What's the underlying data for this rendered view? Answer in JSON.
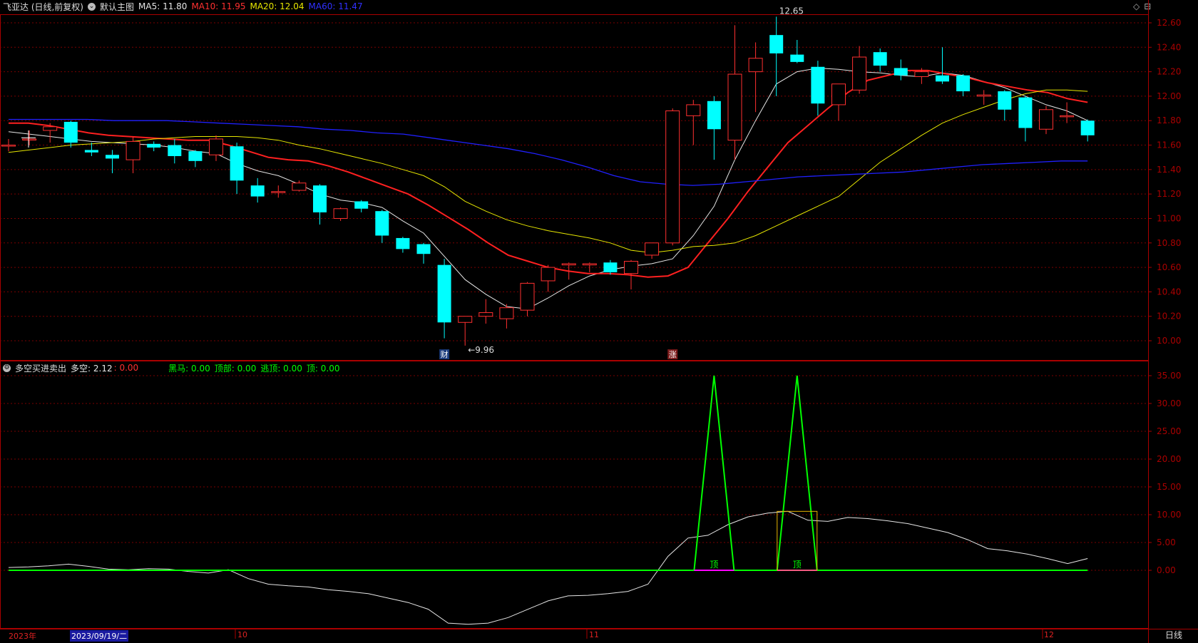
{
  "main_header": {
    "title": "飞亚达 (日线,前复权)",
    "main_label": "默认主图",
    "ma5": "MA5: 11.80",
    "ma10": "MA10: 11.95",
    "ma20": "MA20: 12.04",
    "ma60": "MA60: 11.47"
  },
  "sub_header": {
    "title": "多空买进卖出",
    "duokong": "多空: 2.12",
    "zero": ": 0.00",
    "heima": "黑马: 0.00",
    "dingbu": "顶部: 0.00",
    "taoding": "逃顶: 0.00",
    "ding": "顶: 0.00"
  },
  "date_axis": {
    "labels": [
      "2023年",
      "10",
      "11",
      "12"
    ],
    "selected_date": "2023/09/19/二",
    "period_button": "日线"
  },
  "colors": {
    "up": "#ff3030",
    "down": "#00ffff",
    "ma5": "#e6e6e6",
    "ma10": "#ff2020",
    "ma20": "#e6e600",
    "ma60": "#2020ff",
    "grid": "#7a0000",
    "axis": "#aa0000",
    "green": "#00ff00",
    "magenta": "#ff00ff"
  },
  "chart_data": [
    {
      "type": "candlestick",
      "name": "main",
      "ylim": [
        9.85,
        12.75
      ],
      "yticks": [
        "12.60",
        "12.40",
        "12.20",
        "12.00",
        "11.80",
        "11.60",
        "11.40",
        "11.20",
        "11.00",
        "10.80",
        "10.60",
        "10.40",
        "10.20",
        "10.00"
      ],
      "candles": [
        {
          "o": 11.6,
          "h": 11.65,
          "l": 11.55,
          "c": 11.6
        },
        {
          "o": 11.65,
          "h": 11.72,
          "l": 11.6,
          "c": 11.65
        },
        {
          "o": 11.72,
          "h": 11.78,
          "l": 11.62,
          "c": 11.75
        },
        {
          "o": 11.79,
          "h": 11.8,
          "l": 11.58,
          "c": 11.62
        },
        {
          "o": 11.56,
          "h": 11.62,
          "l": 11.51,
          "c": 11.54
        },
        {
          "o": 11.52,
          "h": 11.56,
          "l": 11.37,
          "c": 11.49
        },
        {
          "o": 11.48,
          "h": 11.67,
          "l": 11.37,
          "c": 11.63
        },
        {
          "o": 11.61,
          "h": 11.63,
          "l": 11.55,
          "c": 11.58
        },
        {
          "o": 11.6,
          "h": 11.65,
          "l": 11.45,
          "c": 11.51
        },
        {
          "o": 11.55,
          "h": 11.56,
          "l": 11.42,
          "c": 11.47
        },
        {
          "o": 11.52,
          "h": 11.68,
          "l": 11.47,
          "c": 11.65
        },
        {
          "o": 11.59,
          "h": 11.62,
          "l": 11.2,
          "c": 11.31
        },
        {
          "o": 11.27,
          "h": 11.33,
          "l": 11.13,
          "c": 11.18
        },
        {
          "o": 11.22,
          "h": 11.27,
          "l": 11.17,
          "c": 11.22
        },
        {
          "o": 11.23,
          "h": 11.31,
          "l": 11.22,
          "c": 11.29
        },
        {
          "o": 11.27,
          "h": 11.28,
          "l": 10.95,
          "c": 11.05
        },
        {
          "o": 11.0,
          "h": 11.09,
          "l": 10.98,
          "c": 11.08
        },
        {
          "o": 11.14,
          "h": 11.15,
          "l": 11.05,
          "c": 11.08
        },
        {
          "o": 11.06,
          "h": 11.07,
          "l": 10.8,
          "c": 10.86
        },
        {
          "o": 10.84,
          "h": 10.85,
          "l": 10.72,
          "c": 10.75
        },
        {
          "o": 10.79,
          "h": 10.8,
          "l": 10.63,
          "c": 10.71
        },
        {
          "o": 10.62,
          "h": 10.67,
          "l": 10.02,
          "c": 10.15
        },
        {
          "o": 10.15,
          "h": 10.2,
          "l": 9.96,
          "c": 10.2
        },
        {
          "o": 10.2,
          "h": 10.34,
          "l": 10.14,
          "c": 10.23
        },
        {
          "o": 10.18,
          "h": 10.3,
          "l": 10.1,
          "c": 10.27
        },
        {
          "o": 10.25,
          "h": 10.48,
          "l": 10.2,
          "c": 10.47
        },
        {
          "o": 10.49,
          "h": 10.62,
          "l": 10.4,
          "c": 10.6
        },
        {
          "o": 10.62,
          "h": 10.64,
          "l": 10.5,
          "c": 10.63
        },
        {
          "o": 10.62,
          "h": 10.64,
          "l": 10.56,
          "c": 10.63
        },
        {
          "o": 10.64,
          "h": 10.66,
          "l": 10.54,
          "c": 10.56
        },
        {
          "o": 10.55,
          "h": 10.66,
          "l": 10.42,
          "c": 10.65
        },
        {
          "o": 10.7,
          "h": 10.8,
          "l": 10.67,
          "c": 10.8
        },
        {
          "o": 10.8,
          "h": 11.9,
          "l": 10.78,
          "c": 11.88
        },
        {
          "o": 11.84,
          "h": 11.97,
          "l": 11.6,
          "c": 11.93
        },
        {
          "o": 11.96,
          "h": 12.0,
          "l": 11.48,
          "c": 11.73
        },
        {
          "o": 11.64,
          "h": 12.58,
          "l": 11.48,
          "c": 12.18
        },
        {
          "o": 12.2,
          "h": 12.44,
          "l": 11.87,
          "c": 12.31
        },
        {
          "o": 12.5,
          "h": 12.65,
          "l": 12.0,
          "c": 12.35
        },
        {
          "o": 12.34,
          "h": 12.46,
          "l": 12.27,
          "c": 12.28
        },
        {
          "o": 12.24,
          "h": 12.29,
          "l": 11.84,
          "c": 11.94
        },
        {
          "o": 11.93,
          "h": 12.1,
          "l": 11.8,
          "c": 12.1
        },
        {
          "o": 12.05,
          "h": 12.41,
          "l": 12.02,
          "c": 12.32
        },
        {
          "o": 12.36,
          "h": 12.39,
          "l": 12.2,
          "c": 12.25
        },
        {
          "o": 12.23,
          "h": 12.3,
          "l": 12.13,
          "c": 12.17
        },
        {
          "o": 12.16,
          "h": 12.23,
          "l": 12.1,
          "c": 12.2
        },
        {
          "o": 12.17,
          "h": 12.4,
          "l": 12.1,
          "c": 12.12
        },
        {
          "o": 12.17,
          "h": 12.18,
          "l": 12.0,
          "c": 12.04
        },
        {
          "o": 12.0,
          "h": 12.05,
          "l": 11.93,
          "c": 12.01
        },
        {
          "o": 12.04,
          "h": 12.05,
          "l": 11.8,
          "c": 11.89
        },
        {
          "o": 11.99,
          "h": 12.0,
          "l": 11.63,
          "c": 11.74
        },
        {
          "o": 11.73,
          "h": 11.92,
          "l": 11.69,
          "c": 11.89
        },
        {
          "o": 11.84,
          "h": 11.95,
          "l": 11.78,
          "c": 11.84
        },
        {
          "o": 11.8,
          "h": 11.81,
          "l": 11.63,
          "c": 11.68
        }
      ],
      "series": [
        {
          "name": "MA5",
          "values": [
            11.71,
            11.69,
            11.67,
            11.65,
            11.63,
            11.62,
            11.61,
            11.6,
            11.58,
            11.55,
            11.53,
            11.45,
            11.39,
            11.35,
            11.28,
            11.2,
            11.15,
            11.13,
            11.09,
            10.98,
            10.88,
            10.69,
            10.5,
            10.38,
            10.28,
            10.26,
            10.35,
            10.45,
            10.53,
            10.58,
            10.61,
            10.63,
            10.67,
            10.86,
            11.1,
            11.48,
            11.8,
            12.1,
            12.2,
            12.23,
            12.22,
            12.2,
            12.19,
            12.17,
            12.16,
            12.19,
            12.17,
            12.12,
            12.07,
            12.0,
            11.93,
            11.88,
            11.8
          ]
        },
        {
          "name": "MA10",
          "values": [
            11.78,
            11.78,
            11.76,
            11.73,
            11.7,
            11.68,
            11.67,
            11.66,
            11.65,
            11.64,
            11.64,
            11.6,
            11.55,
            11.5,
            11.48,
            11.47,
            11.43,
            11.38,
            11.32,
            11.26,
            11.2,
            11.11,
            11.01,
            10.91,
            10.8,
            10.7,
            10.65,
            10.6,
            10.57,
            10.55,
            10.55,
            10.54,
            10.52,
            10.53,
            10.6,
            10.8,
            11.0,
            11.22,
            11.42,
            11.62,
            11.76,
            11.9,
            12.03,
            12.13,
            12.17,
            12.21,
            12.21,
            12.18,
            12.15,
            12.11,
            12.08,
            12.05,
            12.03,
            11.98,
            11.95
          ]
        },
        {
          "name": "MA20",
          "values": [
            11.54,
            11.56,
            11.58,
            11.6,
            11.61,
            11.62,
            11.63,
            11.65,
            11.66,
            11.67,
            11.67,
            11.67,
            11.66,
            11.64,
            11.6,
            11.57,
            11.53,
            11.49,
            11.45,
            11.4,
            11.35,
            11.26,
            11.14,
            11.06,
            10.99,
            10.94,
            10.9,
            10.87,
            10.84,
            10.8,
            10.74,
            10.72,
            10.74,
            10.77,
            10.78,
            10.8,
            10.86,
            10.94,
            11.02,
            11.1,
            11.18,
            11.32,
            11.46,
            11.57,
            11.68,
            11.78,
            11.85,
            11.91,
            11.97,
            12.02,
            12.05,
            12.05,
            12.04
          ]
        },
        {
          "name": "MA60",
          "values": [
            11.81,
            11.81,
            11.81,
            11.81,
            11.8,
            11.8,
            11.8,
            11.79,
            11.78,
            11.77,
            11.76,
            11.75,
            11.73,
            11.72,
            11.7,
            11.69,
            11.66,
            11.63,
            11.6,
            11.57,
            11.53,
            11.48,
            11.42,
            11.35,
            11.3,
            11.28,
            11.27,
            11.28,
            11.3,
            11.32,
            11.34,
            11.35,
            11.36,
            11.37,
            11.38,
            11.4,
            11.42,
            11.44,
            11.45,
            11.46,
            11.47,
            11.47
          ]
        }
      ],
      "annotations": [
        {
          "text": "12.65",
          "candle": 37,
          "price": 12.65
        },
        {
          "text": "←9.96",
          "candle": 22,
          "price": 9.96
        }
      ],
      "markers": [
        {
          "text": "财",
          "candle": 21
        },
        {
          "text": "涨",
          "candle": 32
        }
      ]
    },
    {
      "type": "line",
      "name": "多空买进卖出",
      "ylim": [
        -10,
        37
      ],
      "yticks": [
        "35.00",
        "30.00",
        "25.00",
        "20.00",
        "15.00",
        "10.00",
        "5.00",
        "0.00"
      ],
      "series": [
        {
          "name": "多空",
          "values": [
            0.5,
            0.6,
            0.8,
            1.1,
            0.7,
            0.2,
            0.1,
            0.3,
            0.2,
            -0.2,
            -0.5,
            0.1,
            -1.5,
            -2.5,
            -2.8,
            -3.0,
            -3.5,
            -3.8,
            -4.2,
            -5.0,
            -5.8,
            -7.0,
            -9.5,
            -9.7,
            -9.5,
            -8.5,
            -7.0,
            -5.5,
            -4.6,
            -4.5,
            -4.2,
            -3.8,
            -2.5,
            2.5,
            5.8,
            6.3,
            8.2,
            9.6,
            10.3,
            10.6,
            9.0,
            8.8,
            9.5,
            9.3,
            8.9,
            8.4,
            7.6,
            6.8,
            5.5,
            3.9,
            3.5,
            2.9,
            2.1,
            1.2,
            2.12
          ]
        },
        {
          "name": "黑马",
          "values": [
            0,
            0,
            0,
            0,
            0,
            0,
            0,
            0,
            0,
            0,
            0,
            0,
            0,
            0,
            0,
            0,
            0,
            0,
            0,
            0,
            0,
            0,
            0,
            0,
            0,
            0,
            0,
            0,
            0,
            0,
            0,
            0,
            0,
            0,
            0,
            0,
            0,
            0,
            0,
            0,
            0,
            0,
            0,
            0,
            0,
            0,
            0,
            0,
            0,
            0,
            0,
            0,
            0
          ]
        },
        {
          "name": "顶部",
          "values": [
            0,
            0,
            0,
            0,
            0,
            0,
            0,
            0,
            0,
            0,
            0,
            0,
            0,
            0,
            0,
            0,
            0,
            0,
            0,
            0,
            0,
            0,
            0,
            0,
            0,
            0,
            0,
            0,
            0,
            0,
            0,
            0,
            0,
            0,
            35,
            0,
            0,
            0,
            35,
            0,
            0,
            0,
            0,
            0,
            0,
            0,
            0,
            0,
            0,
            0,
            0,
            0,
            0
          ]
        }
      ],
      "top_labels": [
        {
          "text": "顶",
          "candle": 34
        },
        {
          "text": "顶",
          "candle": 38
        }
      ]
    }
  ]
}
